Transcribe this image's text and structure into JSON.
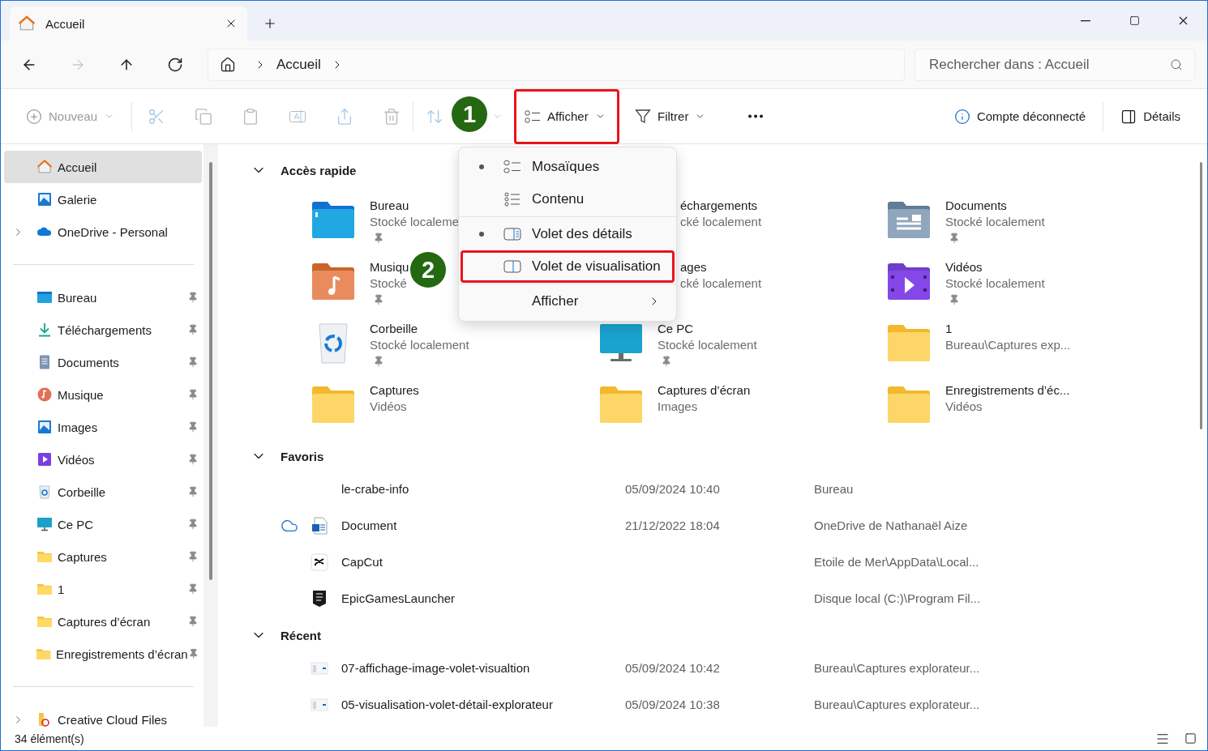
{
  "tab": {
    "title": "Accueil"
  },
  "nav": [
    {
      "kind": "back",
      "disabled": false
    },
    {
      "kind": "forward",
      "disabled": true
    },
    {
      "kind": "up",
      "disabled": false
    },
    {
      "kind": "refresh",
      "disabled": false
    }
  ],
  "address": {
    "path": [
      "Accueil"
    ]
  },
  "search": {
    "placeholder": "Rechercher dans : Accueil"
  },
  "toolbar": {
    "groups": [
      [
        {
          "kind": "new",
          "label": "Nouveau",
          "disabled": true
        }
      ],
      [
        {
          "kind": "cut",
          "disabled": true
        },
        {
          "kind": "copy",
          "disabled": true
        },
        {
          "kind": "paste",
          "disabled": true
        },
        {
          "kind": "rename",
          "disabled": true
        },
        {
          "kind": "share",
          "disabled": true
        },
        {
          "kind": "delete",
          "disabled": true
        }
      ],
      [
        {
          "kind": "sort",
          "disabled": true
        },
        {
          "kind": "view",
          "label": "Afficher",
          "disabled": false,
          "highlighted": true
        },
        {
          "kind": "filter",
          "label": "Filtrer",
          "disabled": false
        },
        {
          "kind": "more",
          "disabled": false
        }
      ]
    ],
    "right": [
      {
        "kind": "account",
        "label": "Compte déconnecté"
      },
      {
        "kind": "details",
        "label": "Détails"
      }
    ]
  },
  "view_menu": {
    "groups": [
      [
        {
          "kind": "tiles",
          "label": "Mosaïques",
          "selected": true,
          "highlighted": false
        },
        {
          "kind": "content",
          "label": "Contenu",
          "selected": false,
          "highlighted": false
        }
      ],
      [
        {
          "kind": "details",
          "label": "Volet des détails",
          "selected": true,
          "highlighted": false
        },
        {
          "kind": "preview",
          "label": "Volet de visualisation",
          "selected": false,
          "highlighted": true
        }
      ],
      [
        {
          "kind": "submenu",
          "label": "Afficher",
          "selected": false,
          "highlighted": false
        }
      ]
    ]
  },
  "annotations": [
    {
      "label": "1"
    },
    {
      "label": "2"
    }
  ],
  "sidebar": {
    "groups": [
      [
        {
          "label": "Accueil",
          "kind": "home",
          "selected": true
        },
        {
          "label": "Galerie",
          "kind": "gallery",
          "selected": false
        },
        {
          "label": "OneDrive - Personal",
          "kind": "onedrive",
          "selected": false,
          "expanded": false
        }
      ],
      [
        {
          "label": "Bureau",
          "kind": "desktop",
          "selected": false,
          "pinned": true
        },
        {
          "label": "Téléchargements",
          "kind": "download",
          "selected": false,
          "pinned": true
        },
        {
          "label": "Documents",
          "kind": "documents",
          "selected": false,
          "pinned": true
        },
        {
          "label": "Musique",
          "kind": "music",
          "selected": false,
          "pinned": true
        },
        {
          "label": "Images",
          "kind": "images",
          "selected": false,
          "pinned": true
        },
        {
          "label": "Vidéos",
          "kind": "videos",
          "selected": false,
          "pinned": true
        },
        {
          "label": "Corbeille",
          "kind": "recycle",
          "selected": false,
          "pinned": true
        },
        {
          "label": "Ce PC",
          "kind": "pc",
          "selected": false,
          "pinned": true
        },
        {
          "label": "Captures",
          "kind": "folder",
          "selected": false,
          "pinned": true
        },
        {
          "label": "1",
          "kind": "folder",
          "selected": false,
          "pinned": true
        },
        {
          "label": "Captures d’écran",
          "kind": "folder",
          "selected": false,
          "pinned": true
        },
        {
          "label": "Enregistrements d’écran",
          "kind": "folder",
          "selected": false,
          "pinned": true
        }
      ],
      [
        {
          "label": "Creative Cloud Files",
          "kind": "creative",
          "selected": false,
          "expanded": false
        }
      ]
    ]
  },
  "quick_access": {
    "title": "Accès rapide",
    "expanded": true,
    "tiles": [
      {
        "name": "Bureau",
        "detail": "Stocké localeme",
        "kind": "desktop",
        "pinned": true
      },
      {
        "name": "échargements",
        "detail": "cké localement",
        "kind": "covered"
      },
      {
        "name": "Documents",
        "detail": "Stocké localement",
        "kind": "documents",
        "pinned": true
      },
      {
        "name": "Musiqu",
        "detail": "Stocké",
        "kind": "music",
        "pinned": true
      },
      {
        "name": "ages",
        "detail": "cké localement",
        "kind": "covered"
      },
      {
        "name": "Vidéos",
        "detail": "Stocké localement",
        "kind": "videos",
        "pinned": true
      },
      {
        "name": "Corbeille",
        "detail": "Stocké localement",
        "kind": "recycle",
        "pinned": true
      },
      {
        "name": "Ce PC",
        "detail": "Stocké localement",
        "kind": "pc",
        "pinned": true
      },
      {
        "name": "1",
        "detail": "Bureau\\Captures exp...",
        "kind": "folder"
      },
      {
        "name": "Captures",
        "detail": "Vidéos",
        "kind": "folder"
      },
      {
        "name": "Captures d’écran",
        "detail": "Images",
        "kind": "folder"
      },
      {
        "name": "Enregistrements d’éc...",
        "detail": "Vidéos",
        "kind": "folder"
      }
    ]
  },
  "favorites": {
    "title": "Favoris",
    "expanded": true,
    "rows": [
      {
        "name": "le-crabe-info",
        "date": "05/09/2024 10:40",
        "location": "Bureau",
        "cloud": false,
        "kind": "link"
      },
      {
        "name": "Document",
        "date": "21/12/2022 18:04",
        "location": "OneDrive de Nathanaël Aize",
        "cloud": true,
        "kind": "word"
      },
      {
        "name": "CapCut",
        "location": "Etoile de Mer\\AppData\\Local...",
        "cloud": false,
        "kind": "capcut"
      },
      {
        "name": "EpicGamesLauncher",
        "location": "Disque local (C:)\\Program Fil...",
        "cloud": false,
        "kind": "epic"
      }
    ]
  },
  "recent": {
    "title": "Récent",
    "expanded": true,
    "rows": [
      {
        "name": "07-affichage-image-volet-visualtion",
        "date": "05/09/2024 10:42",
        "location": "Bureau\\Captures explorateur...",
        "cloud": false,
        "kind": "thumb"
      },
      {
        "name": "05-visualisation-volet-détail-explorateur",
        "date": "05/09/2024 10:38",
        "location": "Bureau\\Captures explorateur...",
        "cloud": false,
        "kind": "thumb"
      }
    ]
  },
  "status_bar": {
    "count": "34 élément(s)"
  }
}
